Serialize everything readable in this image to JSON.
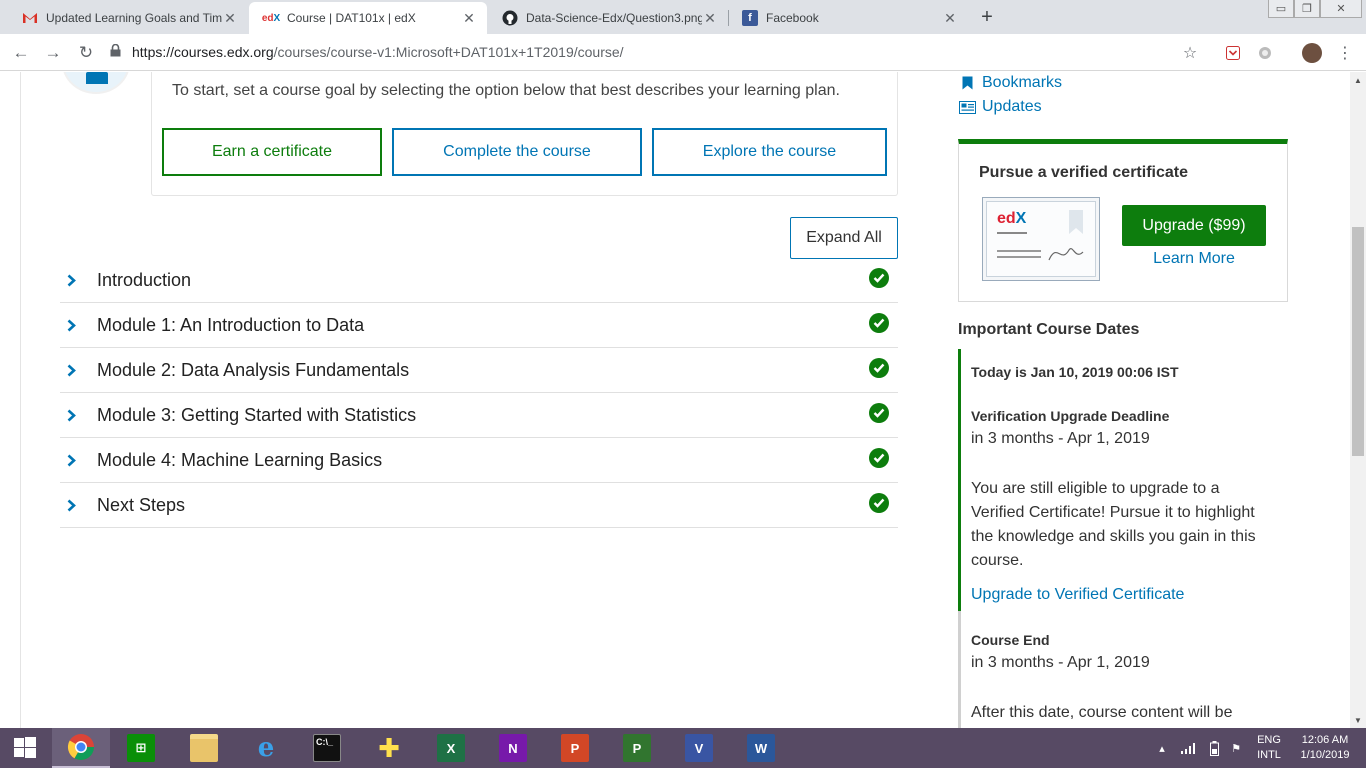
{
  "browser": {
    "tabs": [
      {
        "title": "Updated Learning Goals and Tim",
        "favicon": "gmail-icon",
        "active": false
      },
      {
        "title": "Course | DAT101x | edX",
        "favicon": "edx-icon",
        "active": true
      },
      {
        "title": "Data-Science-Edx/Question3.png",
        "favicon": "github-icon",
        "active": false
      },
      {
        "title": "Facebook",
        "favicon": "facebook-icon",
        "active": false
      }
    ],
    "new_tab": "+",
    "url_host": "https://courses.edx.org",
    "url_path": "/courses/course-v1:Microsoft+DAT101x+1T2019/course/"
  },
  "goal": {
    "prompt": "To start, set a course goal by selecting the option below that best describes your learning plan.",
    "options": [
      "Earn a certificate",
      "Complete the course",
      "Explore the course"
    ]
  },
  "outline": {
    "expand_all": "Expand All",
    "sections": [
      {
        "title": "Introduction",
        "complete": true
      },
      {
        "title": "Module 1: An Introduction to Data",
        "complete": true
      },
      {
        "title": "Module 2: Data Analysis Fundamentals",
        "complete": true
      },
      {
        "title": "Module 3: Getting Started with Statistics",
        "complete": true
      },
      {
        "title": "Module 4: Machine Learning Basics",
        "complete": true
      },
      {
        "title": "Next Steps",
        "complete": true
      }
    ]
  },
  "sidebar": {
    "links": [
      {
        "label": "Bookmarks",
        "icon": "bookmark-icon"
      },
      {
        "label": "Updates",
        "icon": "newspaper-icon"
      }
    ],
    "verified": {
      "title": "Pursue a verified certificate",
      "upgrade_label": "Upgrade ($99)",
      "learn_more": "Learn More",
      "cert_logo": "edX"
    },
    "dates": {
      "title": "Important Course Dates",
      "today": "Today is Jan 10, 2019 00:06 IST",
      "deadline_title": "Verification Upgrade Deadline",
      "deadline_when": "in 3 months - Apr 1, 2019",
      "deadline_desc": [
        "You are still eligible to upgrade to a",
        "Verified Certificate! Pursue it to highlight",
        "the knowledge and skills you gain in this",
        "course."
      ],
      "upgrade_link": "Upgrade to Verified Certificate",
      "end_title": "Course End",
      "end_when": "in 3 months - Apr 1, 2019",
      "end_desc": "After this date, course content will be"
    }
  },
  "taskbar": {
    "apps": [
      "Chrome",
      "Store",
      "File Explorer",
      "Internet Explorer",
      "Command Prompt",
      "App",
      "Excel",
      "OneNote",
      "PowerPoint",
      "Project",
      "Visio",
      "Word"
    ],
    "lang_top": "ENG",
    "lang_bottom": "INTL",
    "time": "12:06 AM",
    "date": "1/10/2019"
  },
  "colors": {
    "edx_blue": "#0075b4",
    "success_green": "#0d7d0d",
    "taskbar": "#574a64"
  }
}
